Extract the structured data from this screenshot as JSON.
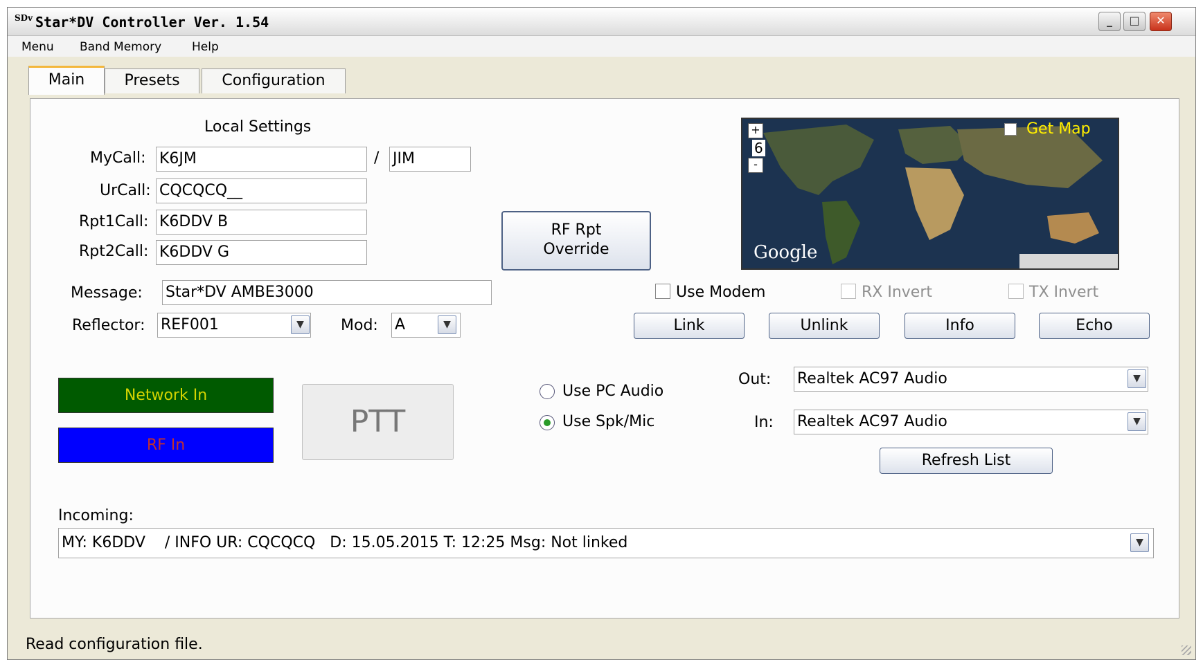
{
  "window": {
    "icon_text": "SDv",
    "title": "Star*DV Controller Ver. 1.54",
    "min_glyph": "_",
    "max_glyph": "□",
    "close_glyph": "✕"
  },
  "menubar": [
    "Menu",
    "Band Memory",
    "Help"
  ],
  "tabs": [
    {
      "label": "Main",
      "active": true
    },
    {
      "label": "Presets",
      "active": false
    },
    {
      "label": "Configuration",
      "active": false
    }
  ],
  "local_settings": {
    "heading": "Local Settings",
    "mycall_label": "MyCall:",
    "mycall": "K6JM",
    "slash": "/",
    "suffix": "JIM",
    "urcall_label": "UrCall:",
    "urcall": "CQCQCQ__",
    "rpt1_label": "Rpt1Call:",
    "rpt1": "K6DDV  B",
    "rpt2_label": "Rpt2Call:",
    "rpt2": "K6DDV  G"
  },
  "rf_override": {
    "line1": "RF Rpt",
    "line2": "Override"
  },
  "map": {
    "zoom_in": "+",
    "zoom_level": "6",
    "zoom_out": "-",
    "get_map_label": "Get Map",
    "get_map_checked": false,
    "brand": "Google",
    "accent_color": "#ffee00"
  },
  "message": {
    "label": "Message:",
    "value": "Star*DV AMBE3000"
  },
  "reflector": {
    "label": "Reflector:",
    "value": "REF001",
    "mod_label": "Mod:",
    "mod_value": "A"
  },
  "modem": {
    "use_modem": "Use Modem",
    "rx_invert": "RX Invert",
    "tx_invert": "TX Invert",
    "use_modem_checked": false,
    "rx_invert_enabled": false,
    "tx_invert_enabled": false
  },
  "actions": {
    "link": "Link",
    "unlink": "Unlink",
    "info": "Info",
    "echo": "Echo"
  },
  "indicators": {
    "network_in": "Network In",
    "network_color": "#005a00",
    "rf_in": "RF In",
    "rf_color": "#0000ff",
    "ptt": "PTT"
  },
  "audio": {
    "use_pc_audio": "Use PC Audio",
    "use_spk_mic": "Use Spk/Mic",
    "selected": "Use Spk/Mic",
    "out_label": "Out:",
    "out_value": "Realtek AC97 Audio",
    "in_label": "In:",
    "in_value": "Realtek AC97 Audio",
    "refresh": "Refresh List"
  },
  "incoming": {
    "label": "Incoming:",
    "value": "MY: K6DDV    / INFO UR: CQCQCQ   D: 15.05.2015 T: 12:25 Msg: Not linked"
  },
  "status_bar": "Read configuration file.",
  "dropdown_glyph": "▼"
}
